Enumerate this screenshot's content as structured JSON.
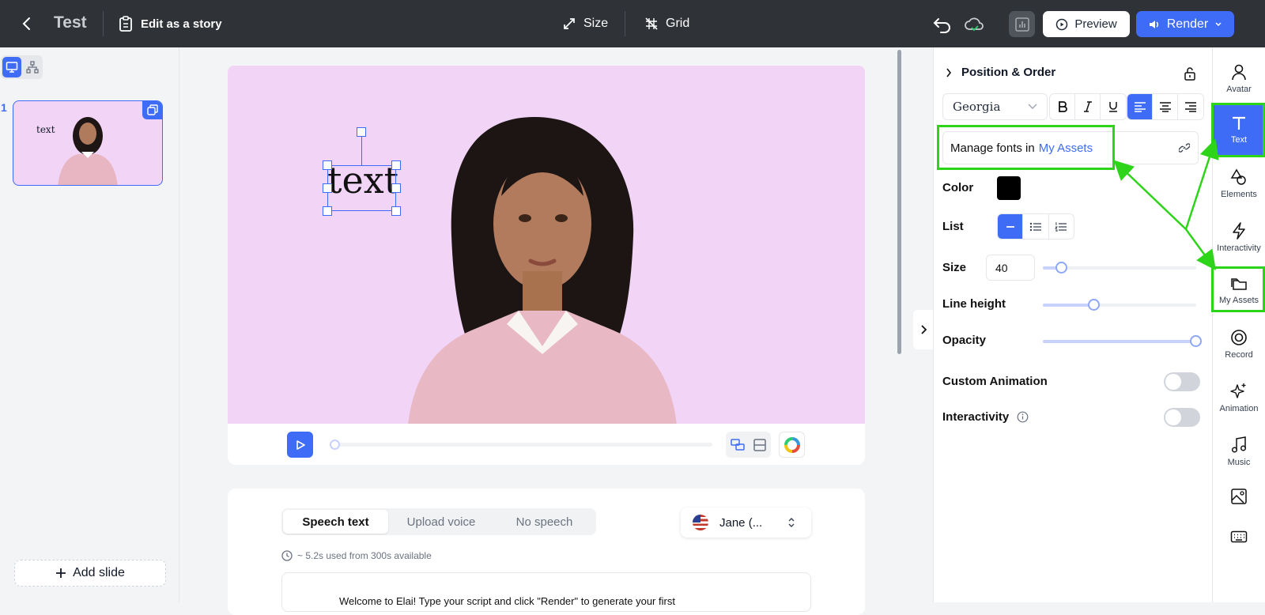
{
  "topbar": {
    "title": "Test",
    "story_label": "Edit as a story",
    "size_label": "Size",
    "grid_label": "Grid",
    "preview_label": "Preview",
    "render_label": "Render"
  },
  "slides": {
    "items": [
      {
        "number": "1",
        "thumb_text": "text"
      }
    ],
    "add_label": "Add slide"
  },
  "canvas": {
    "background": "#f2d4f7",
    "text": "text"
  },
  "speech": {
    "tabs": [
      "Speech text",
      "Upload voice",
      "No speech"
    ],
    "active_tab": "Speech text",
    "voice": "Jane (...",
    "usage": "~ 5.2s used from 300s available",
    "script": "Welcome to Elai! Type your script and click \"Render\" to generate your first"
  },
  "props": {
    "section_title": "Position & Order",
    "font": "Georgia",
    "manage_fonts_text": "Manage fonts in",
    "manage_fonts_link": "My Assets",
    "color_label": "Color",
    "color_value": "#000000",
    "list_label": "List",
    "size_label": "Size",
    "size_value": "40",
    "line_height_label": "Line height",
    "opacity_label": "Opacity",
    "custom_animation_label": "Custom Animation",
    "interactivity_label": "Interactivity",
    "size_level": 0.12,
    "line_height_level": 0.33,
    "opacity_level": 1.0
  },
  "rail": {
    "items": [
      {
        "label": "Avatar",
        "icon": "person-icon"
      },
      {
        "label": "Text",
        "icon": "text-icon",
        "active": true
      },
      {
        "label": "Elements",
        "icon": "shapes-icon"
      },
      {
        "label": "Interactivity",
        "icon": "bolt-icon"
      },
      {
        "label": "My Assets",
        "icon": "folders-icon"
      },
      {
        "label": "Record",
        "icon": "record-icon"
      },
      {
        "label": "Animation",
        "icon": "sparkle-icon"
      },
      {
        "label": "Music",
        "icon": "music-icon"
      },
      {
        "label": "",
        "icon": "image-icon"
      },
      {
        "label": "",
        "icon": "keyboard-icon"
      }
    ]
  },
  "colors": {
    "accent": "#3f6cf6",
    "topbar": "#2f3237",
    "annotation": "#2ed41a"
  }
}
